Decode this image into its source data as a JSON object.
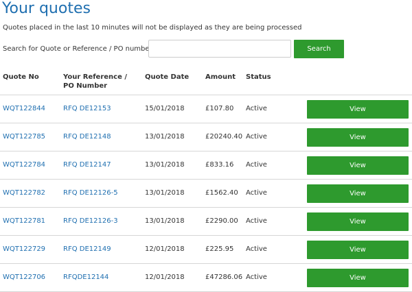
{
  "page": {
    "title": "Your quotes",
    "notice": "Quotes placed in the last 10 minutes will not be displayed as they are being processed"
  },
  "search": {
    "label": "Search for Quote or Reference / PO number",
    "value": "",
    "placeholder": "",
    "button_label": "Search"
  },
  "colors": {
    "accent": "#1f6fb0",
    "button": "#2e9a2e"
  },
  "table": {
    "headers": {
      "quote_no": "Quote No",
      "reference": "Your Reference / PO Number",
      "quote_date": "Quote Date",
      "amount": "Amount",
      "status": "Status"
    },
    "rows": [
      {
        "quote_no": "WQT122844",
        "reference": "RFQ DE12153",
        "date": "15/01/2018",
        "amount": "£107.80",
        "status": "Active",
        "action": "View"
      },
      {
        "quote_no": "WQT122785",
        "reference": "RFQ DE12148",
        "date": "13/01/2018",
        "amount": "£20240.40",
        "status": "Active",
        "action": "View"
      },
      {
        "quote_no": "WQT122784",
        "reference": "RFQ DE12147",
        "date": "13/01/2018",
        "amount": "£833.16",
        "status": "Active",
        "action": "View"
      },
      {
        "quote_no": "WQT122782",
        "reference": "RFQ DE12126-5",
        "date": "13/01/2018",
        "amount": "£1562.40",
        "status": "Active",
        "action": "View"
      },
      {
        "quote_no": "WQT122781",
        "reference": "RFQ DE12126-3",
        "date": "13/01/2018",
        "amount": "£2290.00",
        "status": "Active",
        "action": "View"
      },
      {
        "quote_no": "WQT122729",
        "reference": "RFQ DE12149",
        "date": "12/01/2018",
        "amount": "£225.95",
        "status": "Active",
        "action": "View"
      },
      {
        "quote_no": "WQT122706",
        "reference": "RFQDE12144",
        "date": "12/01/2018",
        "amount": "£47286.06",
        "status": "Active",
        "action": "View"
      }
    ]
  }
}
